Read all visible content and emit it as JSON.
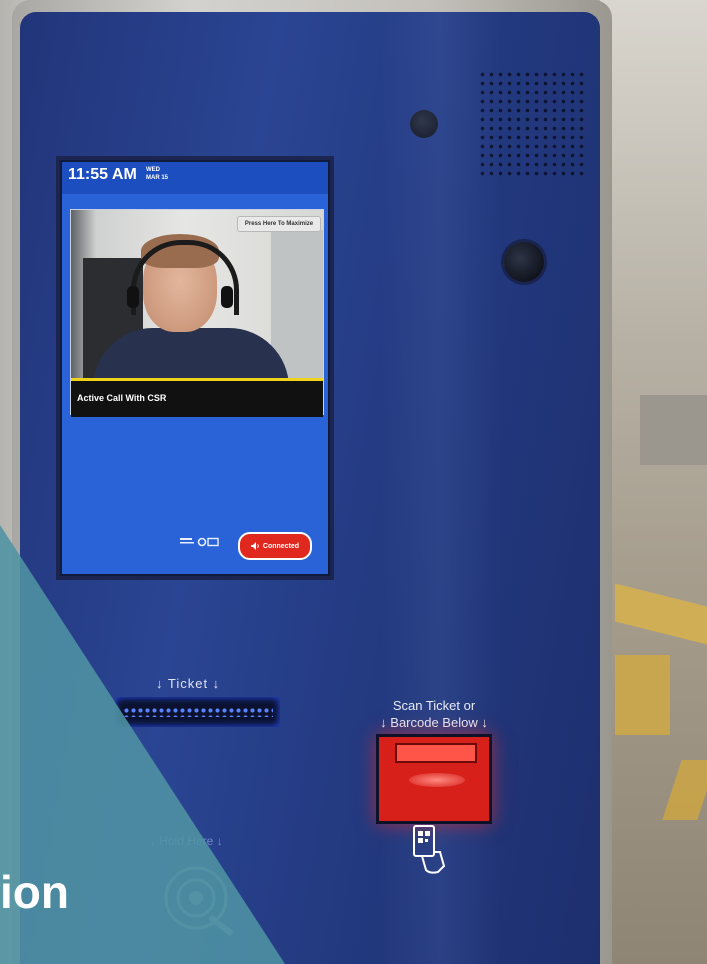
{
  "screen": {
    "clock_time": "11:55 AM",
    "clock_weekday": "WED",
    "clock_date": "MAR 15",
    "maximize_label": "Press Here To Maximize",
    "caption": "Active Call With CSR",
    "connected_label": "Connected"
  },
  "kiosk": {
    "ticket_label": "↓ Ticket ↓",
    "scan_label_line1": "Scan Ticket or",
    "scan_label_line2": "↓ Barcode Below ↓",
    "hold_label": "↓ Hold Here ↓"
  },
  "overlay": {
    "text": "ion",
    "color": "#4f93a3"
  },
  "colors": {
    "kiosk_blue": "#2a4593",
    "screen_blue": "#2a63d8",
    "connected_red": "#e0281e",
    "scanner_red": "#d8201b",
    "caption_accent": "#f0d21a"
  }
}
